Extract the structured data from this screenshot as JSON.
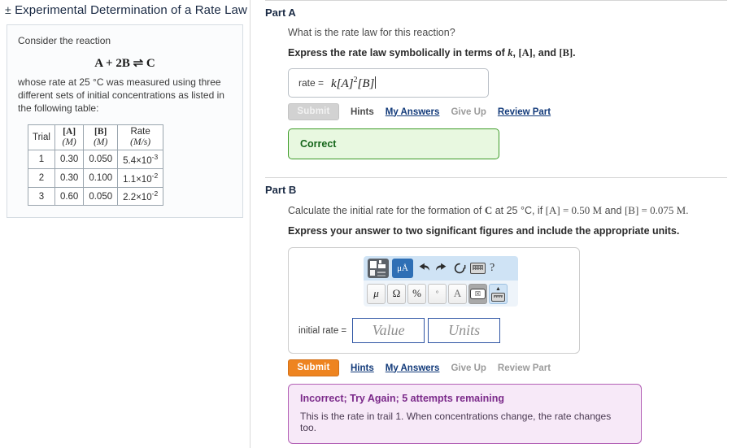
{
  "problem": {
    "toggle": "±",
    "title": "Experimental Determination of a Rate Law",
    "intro_line": "Consider the reaction",
    "equation": "A + 2B ⇌ C",
    "description": "whose rate at 25 °C was measured using three different sets of initial concentrations as listed in the following table:",
    "table": {
      "headers": [
        "Trial",
        "[A] (M)",
        "[B] (M)",
        "Rate (M/s)"
      ],
      "header_parts": [
        {
          "line1": "Trial",
          "line2": ""
        },
        {
          "line1": "[A]",
          "line2": "(M)"
        },
        {
          "line1": "[B]",
          "line2": "(M)"
        },
        {
          "line1": "Rate",
          "line2": "(M/s)"
        }
      ],
      "rows": [
        {
          "trial": "1",
          "a": "0.30",
          "b": "0.050",
          "rate_mantissa": "5.4×10",
          "rate_exp": "-3"
        },
        {
          "trial": "2",
          "a": "0.30",
          "b": "0.100",
          "rate_mantissa": "1.1×10",
          "rate_exp": "-2"
        },
        {
          "trial": "3",
          "a": "0.60",
          "b": "0.050",
          "rate_mantissa": "2.2×10",
          "rate_exp": "-2"
        }
      ]
    }
  },
  "part_a": {
    "heading": "Part A",
    "question": "What is the rate law for this reaction?",
    "instruction": "Express the rate law symbolically in terms of k, [A], and [B].",
    "answer_label": "rate =",
    "answer_base": "k[A]",
    "answer_exponent": "2",
    "answer_tail": "[B]",
    "actions": {
      "submit": "Submit",
      "hints": "Hints",
      "my_answers": "My Answers",
      "give_up": "Give Up",
      "review_part": "Review Part"
    },
    "feedback": {
      "status": "Correct",
      "border_color": "#3d9b28",
      "background_color": "#e8f8e0",
      "text_color": "#15661a"
    }
  },
  "part_b": {
    "heading": "Part B",
    "question": "Calculate the initial rate for the formation of C at 25 °C, if [A] = 0.50 M and [B] = 0.075 M.",
    "question_parts": {
      "pre": "Calculate the initial rate for the formation of",
      "species": "C",
      "mid": "at 25 °C, if",
      "conc_a": "[A] = 0.50 M",
      "and": "and",
      "conc_b": "[B] = 0.075 M",
      "period": "."
    },
    "instruction": "Express your answer to two significant figures and include the appropriate units.",
    "toolbar": {
      "row1": [
        {
          "name": "template-icon",
          "label": "template"
        },
        {
          "name": "micro-angstrom-units-icon",
          "label": "μÅ"
        },
        {
          "name": "undo-icon",
          "label": "undo"
        },
        {
          "name": "redo-icon",
          "label": "redo"
        },
        {
          "name": "reset-icon",
          "label": "reset"
        },
        {
          "name": "keyboard-icon",
          "label": "keyboard"
        },
        {
          "name": "help-icon",
          "label": "?"
        }
      ],
      "row2": [
        {
          "name": "mu-symbol-button",
          "label": "μ"
        },
        {
          "name": "omega-symbol-button",
          "label": "Ω"
        },
        {
          "name": "percent-symbol-button",
          "label": "%"
        },
        {
          "name": "degree-symbol-button",
          "label": "°"
        },
        {
          "name": "angstrom-symbol-button",
          "label": "A"
        },
        {
          "name": "backspace-button",
          "label": "⌫"
        },
        {
          "name": "toggle-keyboard-button",
          "label": "keyboard"
        }
      ]
    },
    "answer": {
      "label": "initial rate =",
      "value_placeholder": "Value",
      "units_placeholder": "Units",
      "border_color": "#2f55a4"
    },
    "actions": {
      "submit": "Submit",
      "hints": "Hints",
      "my_answers": "My Answers",
      "give_up": "Give Up",
      "review_part": "Review Part"
    },
    "feedback": {
      "title": "Incorrect; Try Again; 5 attempts remaining",
      "body": "This is the rate in trail 1. When concentrations change, the rate changes too.",
      "border_color": "#b25fb5",
      "background_color": "#f7e9f8",
      "title_color": "#7b2a8a"
    }
  }
}
